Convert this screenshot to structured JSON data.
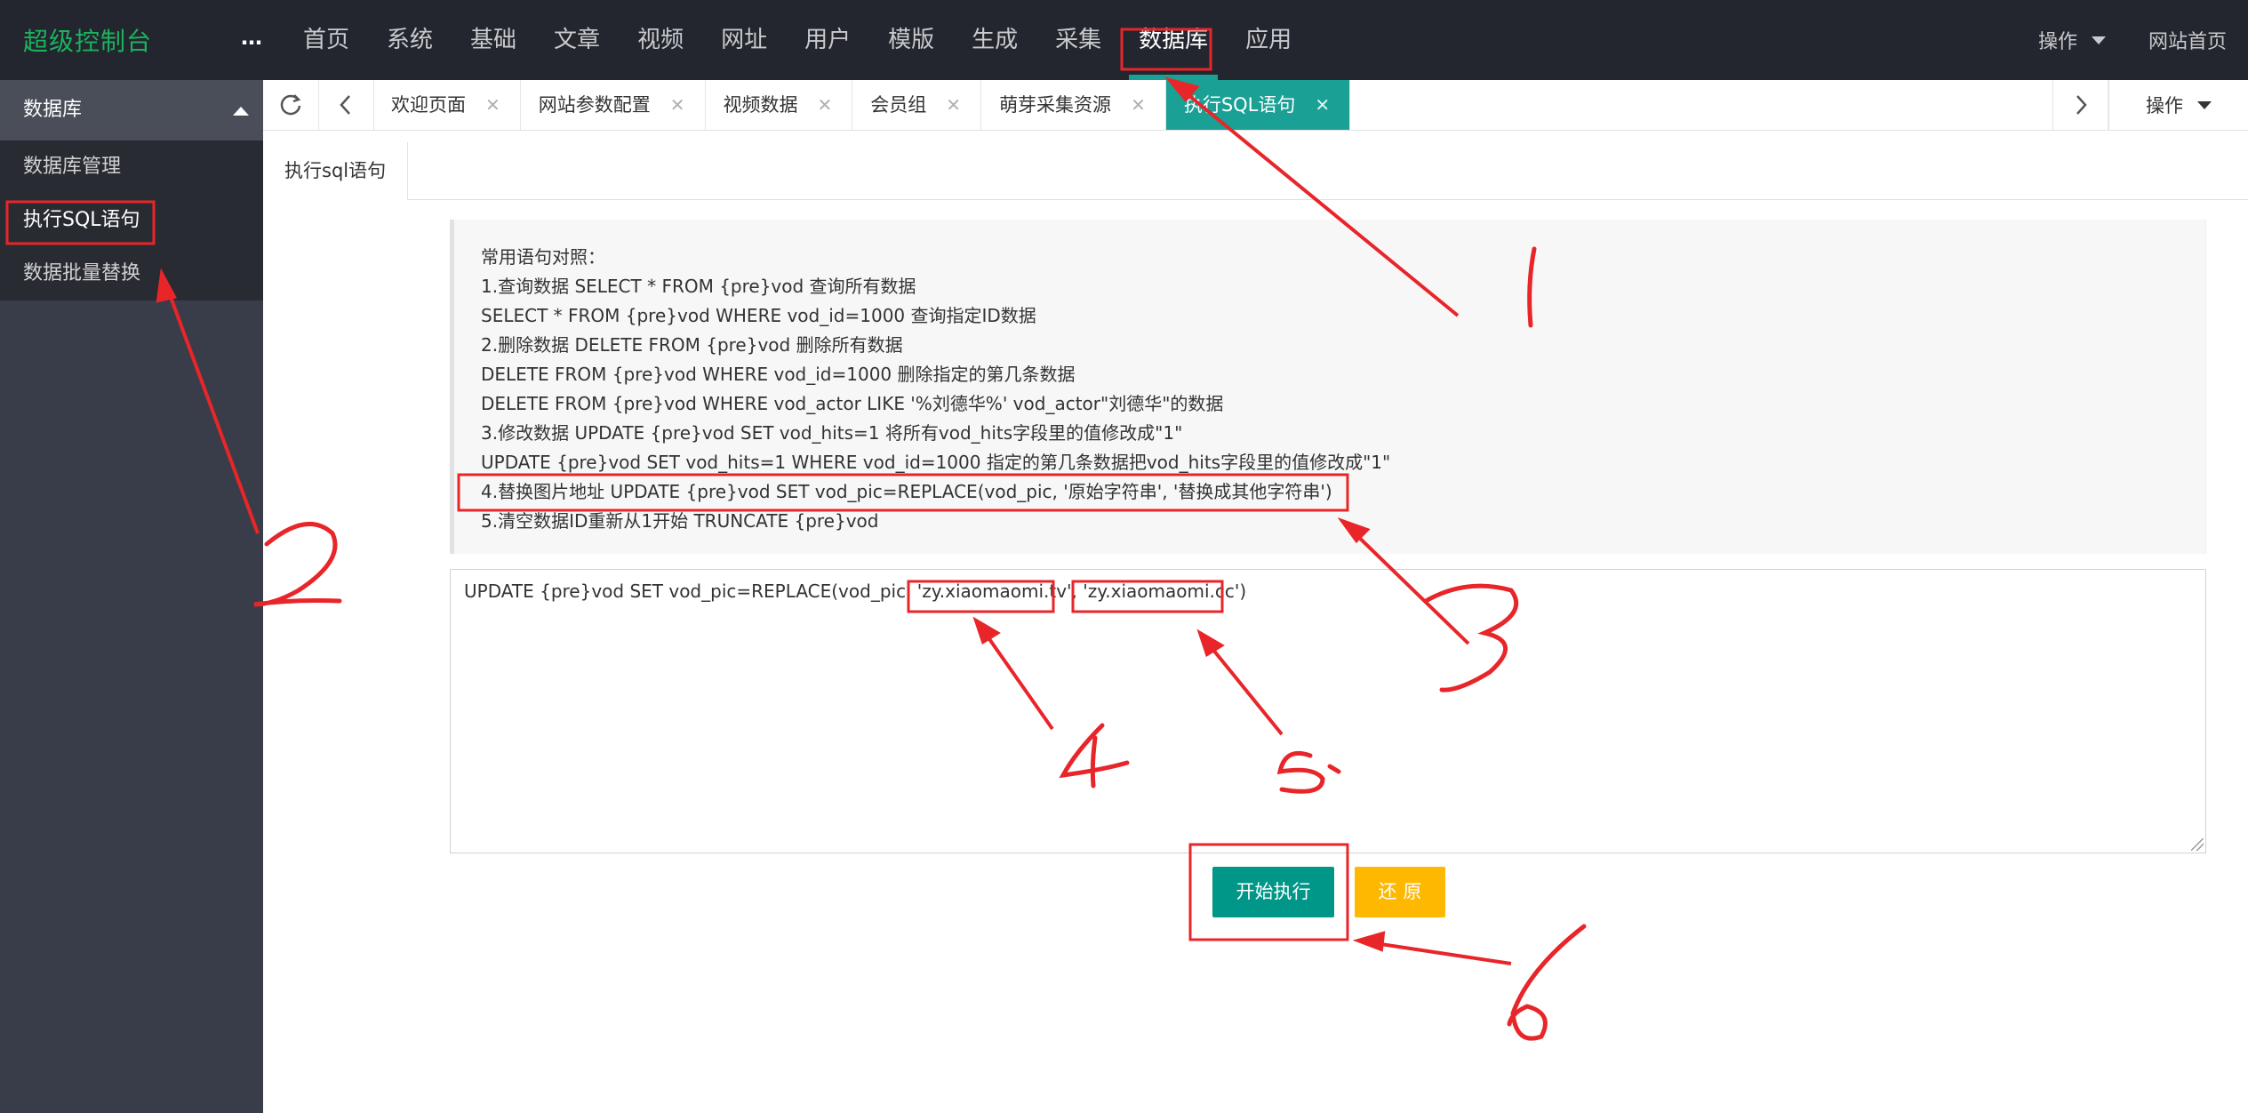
{
  "header": {
    "logo": "超级控制台",
    "more_icon": "…",
    "nav": [
      "首页",
      "系统",
      "基础",
      "文章",
      "视频",
      "网址",
      "用户",
      "模版",
      "生成",
      "采集",
      "数据库",
      "应用"
    ],
    "active_nav": "数据库",
    "right": {
      "ops_label": "操作",
      "site_home": "网站首页"
    }
  },
  "sidebar": {
    "group_title": "数据库",
    "items": [
      "数据库管理",
      "执行SQL语句",
      "数据批量替换"
    ],
    "active_item": "执行SQL语句"
  },
  "tabbar": {
    "refresh_icon": "refresh-icon",
    "tabs": [
      {
        "label": "欢迎页面",
        "close": "✕"
      },
      {
        "label": "网站参数配置",
        "close": "✕"
      },
      {
        "label": "视频数据",
        "close": "✕"
      },
      {
        "label": "会员组",
        "close": "✕"
      },
      {
        "label": "萌芽采集资源",
        "close": "✕"
      },
      {
        "label": "执行SQL语句",
        "close": "✕"
      }
    ],
    "active_tab": "执行SQL语句",
    "ops_label": "操作"
  },
  "content": {
    "tab_label": "执行sql语句",
    "tips": [
      "常用语句对照：",
      "1.查询数据 SELECT * FROM {pre}vod 查询所有数据",
      "SELECT * FROM {pre}vod WHERE vod_id=1000 查询指定ID数据",
      "2.删除数据 DELETE FROM {pre}vod 删除所有数据",
      "DELETE FROM {pre}vod WHERE vod_id=1000 删除指定的第几条数据",
      "DELETE FROM {pre}vod WHERE vod_actor LIKE '%刘德华%' vod_actor\"刘德华\"的数据",
      "3.修改数据 UPDATE {pre}vod SET vod_hits=1 将所有vod_hits字段里的值修改成\"1\"",
      "UPDATE {pre}vod SET vod_hits=1 WHERE vod_id=1000 指定的第几条数据把vod_hits字段里的值修改成\"1\"",
      "4.替换图片地址 UPDATE {pre}vod SET vod_pic=REPLACE(vod_pic, '原始字符串', '替换成其他字符串')",
      "5.清空数据ID重新从1开始 TRUNCATE {pre}vod"
    ],
    "sql_value": "UPDATE {pre}vod SET vod_pic=REPLACE(vod_pic, 'zy.xiaomaomi.tv', 'zy.xiaomaomi.cc')",
    "run_button": "开始执行",
    "reset_button": "还 原"
  },
  "annotations": {
    "accent_color": "#e8262a",
    "numbers": [
      "1",
      "2",
      "3",
      "4",
      "5",
      "6"
    ]
  }
}
